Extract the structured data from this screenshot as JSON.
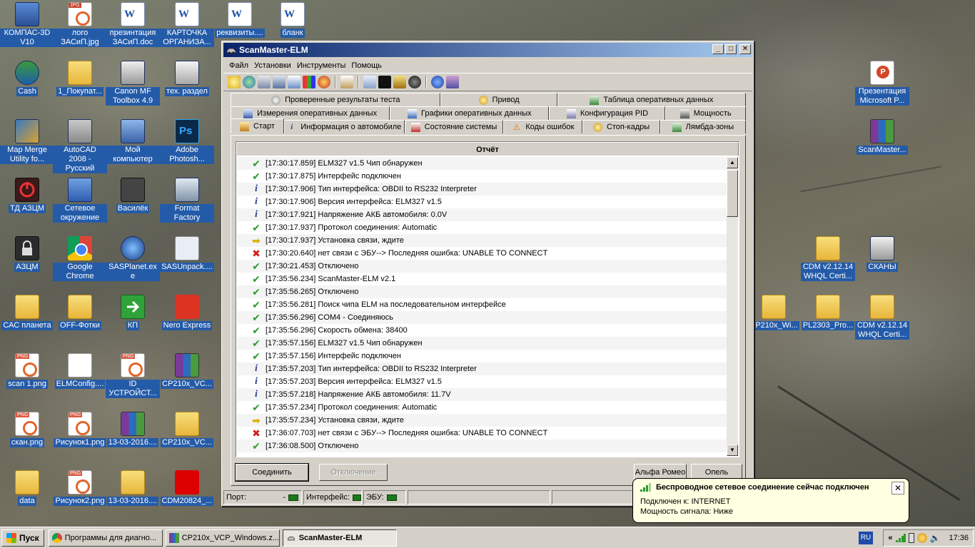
{
  "desktop_icons": [
    {
      "label": "КОМПАС-3D V10",
      "x": 0,
      "y": 0
    },
    {
      "label": "лого ЗАСиП.jpg"
    },
    {
      "label": "презинтация ЗАСиП.doc"
    },
    {
      "label": "КАРТОЧКА ОРГАНИЗА..."
    },
    {
      "label": "реквизиты...."
    },
    {
      "label": "бланк"
    },
    {
      "label": "Cash"
    },
    {
      "label": "1_Покупат..."
    },
    {
      "label": "Canon MF Toolbox 4.9"
    },
    {
      "label": "тех. раздел"
    },
    {
      "label": "Map Merge Utility fo..."
    },
    {
      "label": "AutoCAD 2008 - Русский"
    },
    {
      "label": "Мой компьютер"
    },
    {
      "label": "Adobe Photosh..."
    },
    {
      "label": "ТД АЗЦМ"
    },
    {
      "label": "Сетевое окружение"
    },
    {
      "label": "Василёк"
    },
    {
      "label": "Format Factory"
    },
    {
      "label": "АЗЦМ"
    },
    {
      "label": "Google Chrome"
    },
    {
      "label": "SASPlanet.exe"
    },
    {
      "label": "SASUnpack...."
    },
    {
      "label": "САС планета"
    },
    {
      "label": "OFF-Фотки"
    },
    {
      "label": "КП"
    },
    {
      "label": "Nero Express"
    },
    {
      "label": "scan 1.png"
    },
    {
      "label": "ELMConfig...."
    },
    {
      "label": "ID УСТРОЙСТ..."
    },
    {
      "label": "CP210x_VC..."
    },
    {
      "label": "скан.png"
    },
    {
      "label": "Рисунок1.png"
    },
    {
      "label": "13-03-2016...."
    },
    {
      "label": "CP210x_VC..."
    },
    {
      "label": "data"
    },
    {
      "label": "Рисунок2.png"
    },
    {
      "label": "13-03-2016...."
    },
    {
      "label": "CDM20824_..."
    },
    {
      "label": "Презентация Microsoft P..."
    },
    {
      "label": "ScanMaster..."
    },
    {
      "label": "CDM v2.12.14 WHQL Certi..."
    },
    {
      "label": "СКАНЫ"
    },
    {
      "label": "CP210x_Wi..."
    },
    {
      "label": "PL2303_Pro..."
    },
    {
      "label": "CDM v2.12.14 WHQL Certi..."
    }
  ],
  "window": {
    "title": "ScanMaster-ELM",
    "menu": [
      "Файл",
      "Установки",
      "Инструменты",
      "Помощь"
    ],
    "tabs_row1": [
      "Проверенные результаты теста",
      "Привод",
      "Таблица оперативных данных"
    ],
    "tabs_row2": [
      "Измерения оперативных данных",
      "Графики оперативных данных",
      "Конфигурация PID",
      "Мощность"
    ],
    "tabs_row3": [
      "Старт",
      "Информация о автомобиле",
      "Состояние системы",
      "Коды ошибок",
      "Стоп-кадры",
      "Лямбда-зоны"
    ],
    "log_header": "Отчёт",
    "log": [
      {
        "icon": "ok",
        "text": "[17:30:17.859] ELM327 v1.5 Чип обнаружен"
      },
      {
        "icon": "ok",
        "text": "[17:30:17.875] Интерфейс подключен"
      },
      {
        "icon": "info",
        "text": "[17:30:17.906] Тип интерфейса: OBDII to RS232 Interpreter"
      },
      {
        "icon": "info",
        "text": "[17:30:17.906] Версия интерфейса: ELM327 v1.5"
      },
      {
        "icon": "info",
        "text": "[17:30:17.921] Напряжение АКБ автомобиля: 0.0V"
      },
      {
        "icon": "ok",
        "text": "[17:30:17.937] Протокол соединения: Automatic"
      },
      {
        "icon": "arrow",
        "text": "[17:30:17.937] Установка связи, ждите"
      },
      {
        "icon": "err",
        "text": "[17:30:20.640] нет связи с ЭБУ--> Последняя ошибка: UNABLE TO CONNECT"
      },
      {
        "icon": "ok",
        "text": "[17:30:21.453] Отключено"
      },
      {
        "icon": "ok",
        "text": "[17:35:56.234] ScanMaster-ELM v2.1"
      },
      {
        "icon": "ok",
        "text": "[17:35:56.265] Отключено"
      },
      {
        "icon": "ok",
        "text": "[17:35:56.281] Поиск чипа ELM на последовательном интерфейсе"
      },
      {
        "icon": "ok",
        "text": "[17:35:56.296] COM4 - Соединяюсь"
      },
      {
        "icon": "ok",
        "text": "[17:35:56.296] Скорость обмена: 38400"
      },
      {
        "icon": "ok",
        "text": "[17:35:57.156] ELM327 v1.5 Чип обнаружен"
      },
      {
        "icon": "ok",
        "text": "[17:35:57.156] Интерфейс подключен"
      },
      {
        "icon": "info",
        "text": "[17:35:57.203] Тип интерфейса: OBDII to RS232 Interpreter"
      },
      {
        "icon": "info",
        "text": "[17:35:57.203] Версия интерфейса: ELM327 v1.5"
      },
      {
        "icon": "info",
        "text": "[17:35:57.218] Напряжение АКБ автомобиля: 11.7V"
      },
      {
        "icon": "ok",
        "text": "[17:35:57.234] Протокол соединения: Automatic"
      },
      {
        "icon": "arrow",
        "text": "[17:35:57.234] Установка связи, ждите"
      },
      {
        "icon": "err",
        "text": "[17:36:07.703] нет связи с ЭБУ--> Последняя ошибка: UNABLE TO CONNECT"
      },
      {
        "icon": "ok",
        "text": "[17:36:08.500] Отключено"
      }
    ],
    "buttons": {
      "connect": "Соединить",
      "disconnect": "Отключение",
      "alfa": "Альфа Ромео",
      "opel": "Опель"
    },
    "status": {
      "port_label": "Порт:",
      "port_value": "-",
      "interface_label": "Интерфейс:",
      "ecu_label": "ЭБУ:",
      "url_fragment": "ww"
    }
  },
  "balloon": {
    "title": "Беспроводное сетевое соединение сейчас подключен",
    "line1": "Подключен к: INTERNET",
    "line2": "Мощность сигнала: Ниже"
  },
  "taskbar": {
    "start": "Пуск",
    "tasks": [
      "Программы для диагно...",
      "CP210x_VCP_Windows.z...",
      "ScanMaster-ELM"
    ],
    "lang": "RU",
    "clock": "17:36",
    "tray_chevron": "«"
  }
}
